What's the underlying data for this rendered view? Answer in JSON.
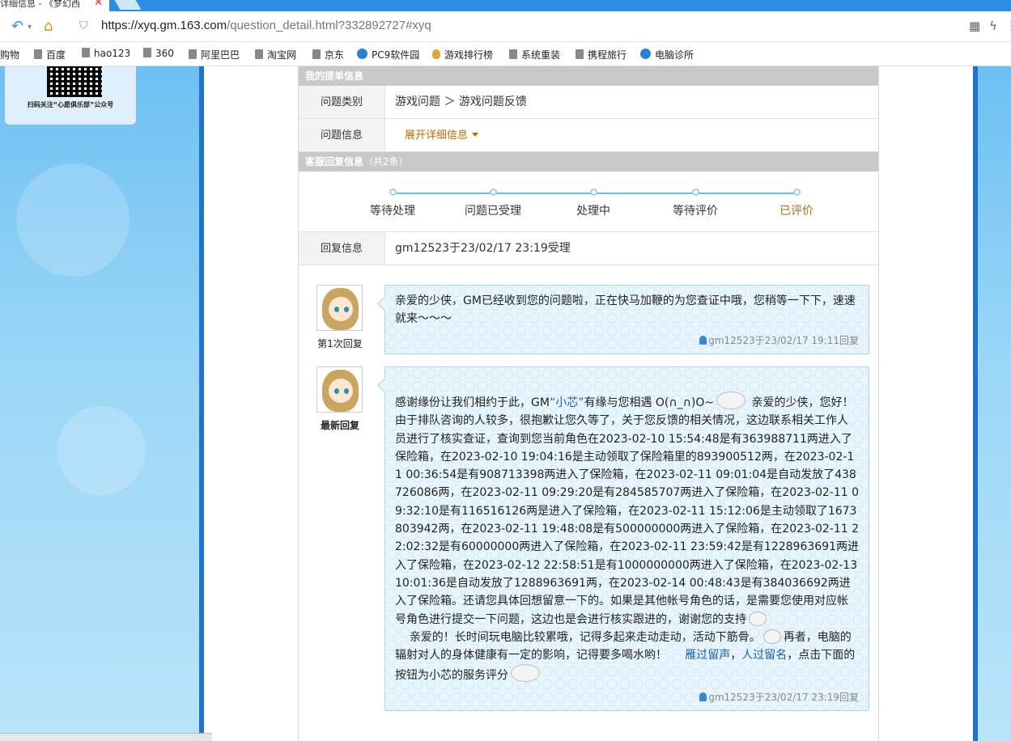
{
  "browser": {
    "tab_title": "详细信息 - 《梦幻西",
    "tab_close": "✕",
    "url_host": "https://xyq.gm.163.com",
    "url_path": "/question_detail.html?332892727#xyq"
  },
  "bookmarks": [
    {
      "label": "购物"
    },
    {
      "label": "百度"
    },
    {
      "label": "hao123"
    },
    {
      "label": "360"
    },
    {
      "label": "阿里巴巴"
    },
    {
      "label": "淘宝网"
    },
    {
      "label": "京东"
    },
    {
      "label": "PC9软件园"
    },
    {
      "label": "游戏排行榜"
    },
    {
      "label": "系统重装"
    },
    {
      "label": "携程旅行"
    },
    {
      "label": "电脑诊所"
    }
  ],
  "sidebar": {
    "qr_caption": "扫码关注“心愿俱乐部”公众号"
  },
  "ticket": {
    "section_title": "我的提单信息",
    "rows": [
      {
        "label": "问题类别",
        "value": "游戏问题 ＞ 游戏问题反馈"
      },
      {
        "label": "问题信息",
        "value": "展开详细信息"
      }
    ]
  },
  "replies_section": {
    "title": "客服回复信息",
    "count": "（共2条）"
  },
  "progress": {
    "steps": [
      "等待处理",
      "问题已受理",
      "处理中",
      "等待评价",
      "已评价"
    ],
    "current_index": 4
  },
  "reply_info": {
    "label": "回复信息",
    "value": "gm12523于23/02/17 23:19受理"
  },
  "replies": [
    {
      "caption": "第1次回复",
      "text": "亲爱的少侠，GM已经收到您的问题啦，正在快马加鞭的为您查证中哦，您稍等一下下，速速就来～～～",
      "meta": "gm12523于23/02/17 19:11回复"
    },
    {
      "caption": "最新回复",
      "text_a": "感谢缘份让我们相约于此，GM",
      "name": "“小芯”",
      "text_b": "有缘与您相遇 O(∩_∩)O~",
      "text_c": "亲爱的少侠，您好！由于排队咨询的人较多，很抱歉让您久等了，关于您反馈的相关情况，这边联系相关工作人员进行了核实查证，查询到您当前角色在2023-02-10 15:54:48是有363988711两进入了保险箱，在2023-02-10 19:04:16是主动领取了保险箱里的893900512两，在2023-02-11 00:36:54是有908713398两进入了保险箱，在2023-02-11 09:01:04是自动发放了438726086两，在2023-02-11 09:29:20是有284585707两进入了保险箱，在2023-02-11 09:32:10是有116516126两是进入了保险箱，在2023-02-11 15:12:06是主动领取了1673803942两，在2023-02-11 19:48:08是有500000000两进入了保险箱，在2023-02-11 22:02:32是有60000000两进入了保险箱，在2023-02-11 23:59:42是有1228963691两进入了保险箱，在2023-02-12 22:58:51是有1000000000两进入了保险箱，在2023-02-13 10:01:36是自动发放了1288963691两，在2023-02-14 00:48:43是有384036692两进入了保险箱。还请您具体回想留意一下的。如果是其他帐号角色的话，是需要您使用对应帐号角色进行提交一下问题，这边也是会进行核实跟进的，谢谢您的支持",
      "text_d": "亲爱的！长时间玩电脑比较累哦，记得多起来走动走动，活动下筋骨。",
      "text_e": "再者，电脑的辐射对人的身体健康有一定的影响，记得要多喝水哟！",
      "link_1": "雁过留声",
      "sep": "，",
      "link_2": "人过留名",
      "text_f": "，点击下面的按钮为小芯的服务评分",
      "meta": "gm12523于23/02/17 23:19回复"
    }
  ]
}
